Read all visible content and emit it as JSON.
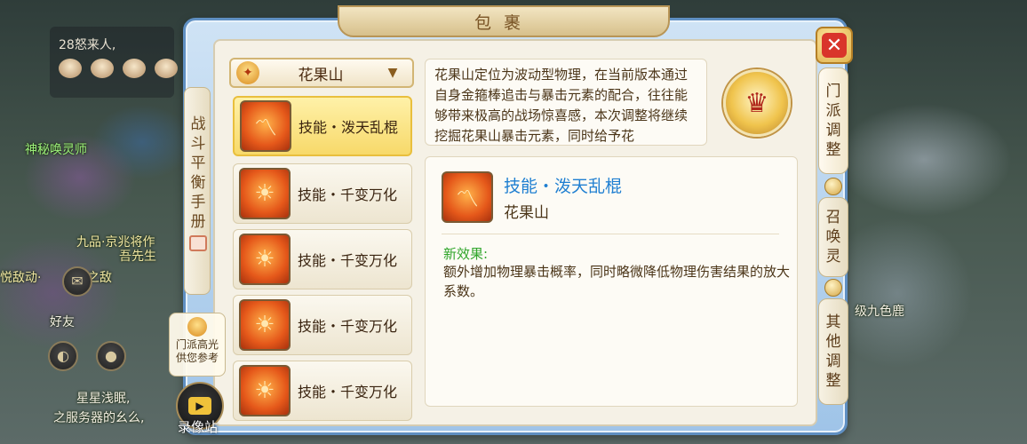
{
  "background": {
    "chat_title": "28怒来人,",
    "labels": {
      "npc1": "神秘唤灵师",
      "npc2": "九品·京兆将作",
      "npc3": "吾先生",
      "npc4": "悦敌动·",
      "npc5": "之敌",
      "friends": "好友",
      "chat_line1": "星星浅眠,",
      "chat_line2": "之服务器的幺么,",
      "right_label": "级九色鹿"
    }
  },
  "dialog": {
    "title": "包裹",
    "left_tab": "战斗平衡手册",
    "right_tabs": [
      "门派调整",
      "召唤灵",
      "其他调整"
    ],
    "close_symbol": "✕"
  },
  "sect_selector": {
    "selected": "花果山",
    "emblem_icon": "sect-emblem-icon"
  },
  "skills": [
    {
      "label": "技能・泼天乱棍",
      "icon": "staff-swirl-icon",
      "selected": true
    },
    {
      "label": "技能・千变万化",
      "icon": "flame-figure-icon",
      "selected": false
    },
    {
      "label": "技能・千变万化",
      "icon": "flame-figure-icon",
      "selected": false
    },
    {
      "label": "技能・千变万化",
      "icon": "flame-figure-icon",
      "selected": false
    },
    {
      "label": "技能・千变万化",
      "icon": "flame-figure-icon",
      "selected": false
    }
  ],
  "description": "花果山定位为波动型物理，在当前版本通过自身金箍棒追击与暴击元素的配合，往往能够带来极高的战场惊喜感，本次调整将继续挖掘花果山暴击元素，同时给予花",
  "detail": {
    "name": "技能・泼天乱棍",
    "sect": "花果山",
    "effect_title": "新效果:",
    "effect_text": "额外增加物理暴击概率，同时略微降低物理伤害结果的放大系数。"
  },
  "floating": {
    "highlight_text": "门派高光\n供您参考",
    "record_label": "录像站"
  },
  "colors": {
    "accent_blue": "#1f7fd1",
    "effect_green": "#2fa52a",
    "close_red": "#d9352b",
    "selected_gold": "#f7d96a"
  }
}
